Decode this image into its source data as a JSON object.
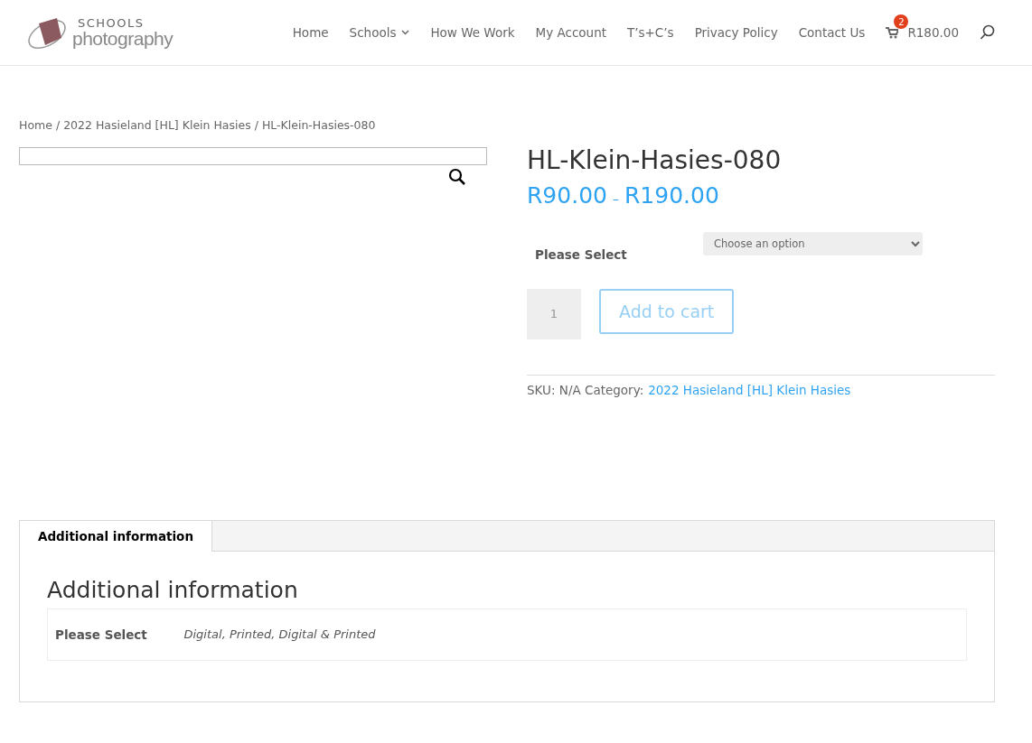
{
  "logo": {
    "line_1": "SCHOOLS",
    "line_2": "photography"
  },
  "nav": {
    "items": [
      {
        "label": "Home",
        "has_submenu": false
      },
      {
        "label": "Schools",
        "has_submenu": true
      },
      {
        "label": "How We Work",
        "has_submenu": false
      },
      {
        "label": "My Account",
        "has_submenu": false
      },
      {
        "label": "T’s+C’s",
        "has_submenu": false
      },
      {
        "label": "Privacy Policy",
        "has_submenu": false
      },
      {
        "label": "Contact Us",
        "has_submenu": false
      }
    ],
    "cart": {
      "count": "2",
      "total": "R180.00"
    }
  },
  "breadcrumb": {
    "separator": "/",
    "items": [
      "Home",
      "2022 Hasieland [HL] Klein Hasies",
      "HL-Klein-Hasies-080"
    ]
  },
  "product": {
    "title": "HL-Klein-Hasies-080",
    "price_min": "R90.00",
    "price_dash": "–",
    "price_max": "R190.00",
    "variation": {
      "label": "Please Select",
      "placeholder": "Choose an option"
    },
    "quantity": "1",
    "add_to_cart": {
      "label": "Add to cart",
      "disabled": true
    },
    "meta": {
      "text": "SKU: N/A Category:",
      "category": "2022 Hasieland [HL] Klein Hasies"
    }
  },
  "tabs": [
    {
      "label": "Additional information",
      "selected": true
    }
  ],
  "panel": {
    "heading": "Additional information",
    "rows": [
      {
        "label": "Please Select",
        "value": "Digital, Printed, Digital & Printed"
      }
    ]
  }
}
